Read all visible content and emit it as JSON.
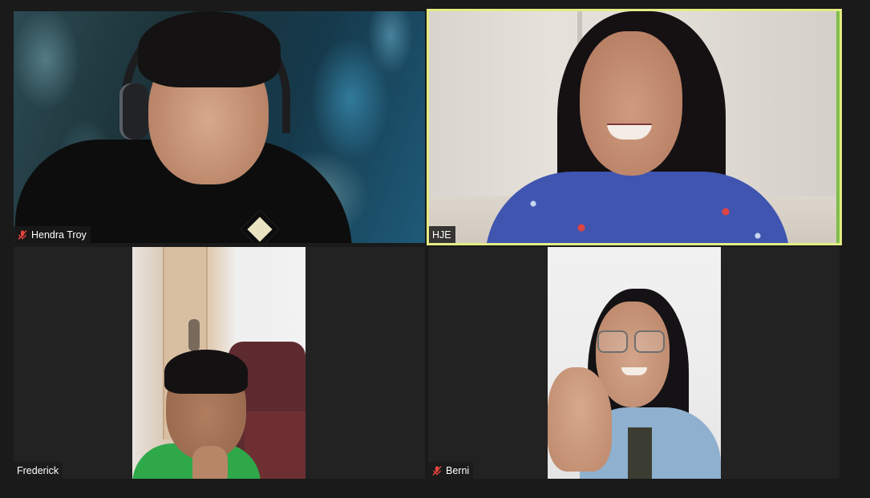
{
  "meeting": {
    "view": "gallery",
    "active_speaker_color": "#e4ec84"
  },
  "participants": [
    {
      "name": "Hendra Troy",
      "muted": true,
      "active_speaker": false
    },
    {
      "name": "HJE",
      "muted": false,
      "active_speaker": true
    },
    {
      "name": "Frederick",
      "muted": false,
      "active_speaker": false
    },
    {
      "name": "Berni",
      "muted": true,
      "active_speaker": false
    }
  ],
  "icons": {
    "muted_mic": "mic-muted-icon",
    "muted_color": "#e8453c"
  }
}
